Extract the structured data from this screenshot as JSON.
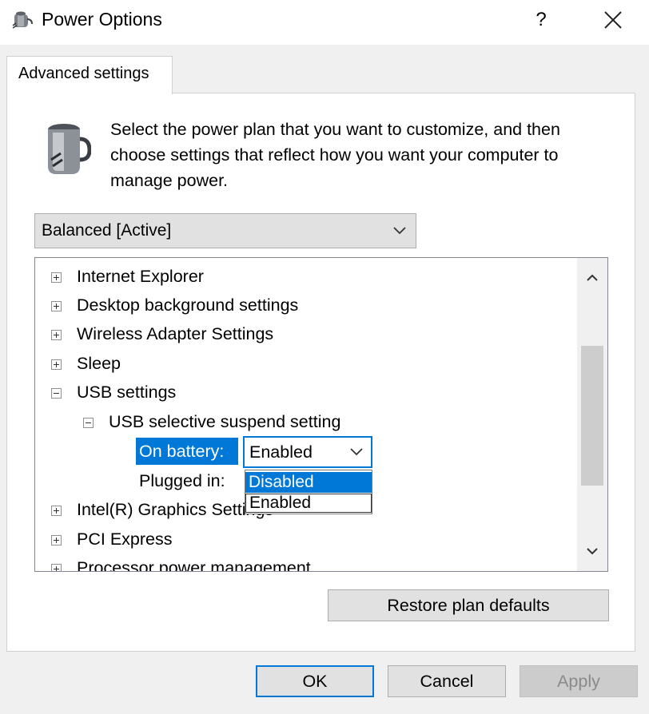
{
  "window": {
    "title": "Power Options",
    "help_label": "?",
    "close_label": "✕"
  },
  "tabs": [
    {
      "label": "Advanced settings"
    }
  ],
  "intro_text": "Select the power plan that you want to customize, and then choose settings that reflect how you want your computer to manage power.",
  "plan_select": {
    "value": "Balanced [Active]"
  },
  "tree": {
    "items": [
      {
        "label": "Internet Explorer",
        "expanded": false
      },
      {
        "label": "Desktop background settings",
        "expanded": false
      },
      {
        "label": "Wireless Adapter Settings",
        "expanded": false
      },
      {
        "label": "Sleep",
        "expanded": false
      },
      {
        "label": "USB settings",
        "expanded": true
      },
      {
        "label": "USB selective suspend setting",
        "expanded": true
      },
      {
        "label": "On battery:"
      },
      {
        "label": "Plugged in:"
      },
      {
        "label": "Intel(R) Graphics Settings",
        "expanded": false
      },
      {
        "label": "PCI Express",
        "expanded": false
      },
      {
        "label": "Processor power management",
        "expanded": false
      }
    ]
  },
  "on_battery_combo": {
    "value": "Enabled",
    "options": [
      "Disabled",
      "Enabled"
    ],
    "highlighted": "Disabled"
  },
  "buttons": {
    "restore": "Restore plan defaults",
    "ok": "OK",
    "cancel": "Cancel",
    "apply": "Apply"
  },
  "colors": {
    "accent": "#0078d7",
    "window_bg": "#f0f0f0"
  }
}
